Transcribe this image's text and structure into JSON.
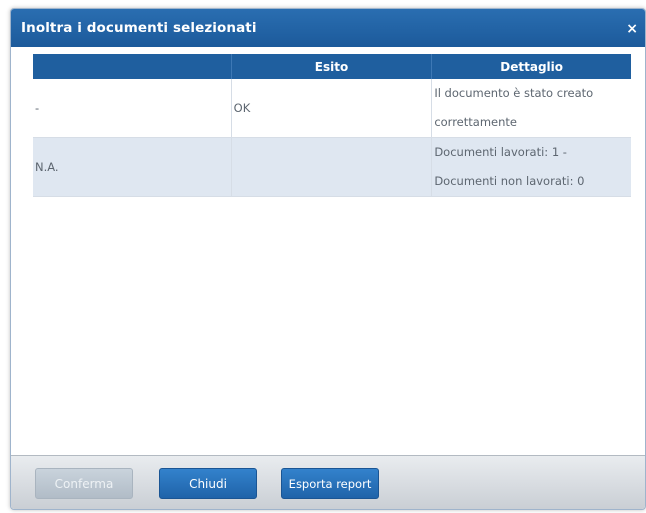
{
  "dialog": {
    "title": "Inoltra i documenti selezionati",
    "close_glyph": "×"
  },
  "table": {
    "columns": [
      "",
      "Esito",
      "Dettaglio"
    ],
    "rows": [
      {
        "col1": "-",
        "esito": "OK",
        "dettaglio_line1": "Il documento è stato creato",
        "dettaglio_line2": "correttamente"
      },
      {
        "col1": "N.A.",
        "esito": "",
        "dettaglio_line1": "Documenti lavorati: 1 -",
        "dettaglio_line2": "Documenti non lavorati: 0"
      }
    ]
  },
  "footer": {
    "conferma_label": "Conferma",
    "chiudi_label": "Chiudi",
    "esporta_label": "Esporta report"
  },
  "colors": {
    "titlebar": "#1f5f9f",
    "header": "#1f5f9f",
    "alt_row": "#dfe7f1",
    "button": "#2a73bd",
    "button_disabled": "#bcc6d0"
  },
  "icons": {
    "close": "close-icon"
  }
}
